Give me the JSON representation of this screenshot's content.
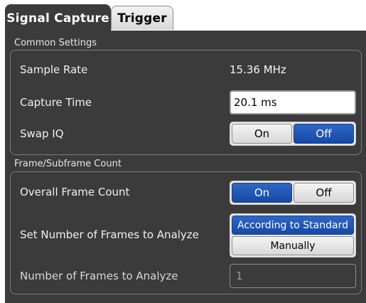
{
  "tabs": [
    {
      "label": "Signal Capture",
      "active": true
    },
    {
      "label": "Trigger",
      "active": false
    }
  ],
  "common_settings": {
    "title": "Common Settings",
    "sample_rate": {
      "label": "Sample Rate",
      "value": "15.36 MHz"
    },
    "capture_time": {
      "label": "Capture Time",
      "value": "20.1 ms"
    },
    "swap_iq": {
      "label": "Swap IQ",
      "on_label": "On",
      "off_label": "Off",
      "selected": "Off"
    }
  },
  "frame_count": {
    "title": "Frame/Subframe Count",
    "overall_frame_count": {
      "label": "Overall Frame Count",
      "on_label": "On",
      "off_label": "Off",
      "selected": "On"
    },
    "set_number": {
      "label": "Set Number of Frames to Analyze",
      "option_standard": "According to Standard",
      "option_manual": "Manually",
      "selected": "According to Standard"
    },
    "number_of_frames": {
      "label": "Number of Frames to Analyze",
      "value": "1"
    }
  },
  "colors": {
    "accent": "#1f56b8",
    "panel": "#3b3b3b"
  }
}
